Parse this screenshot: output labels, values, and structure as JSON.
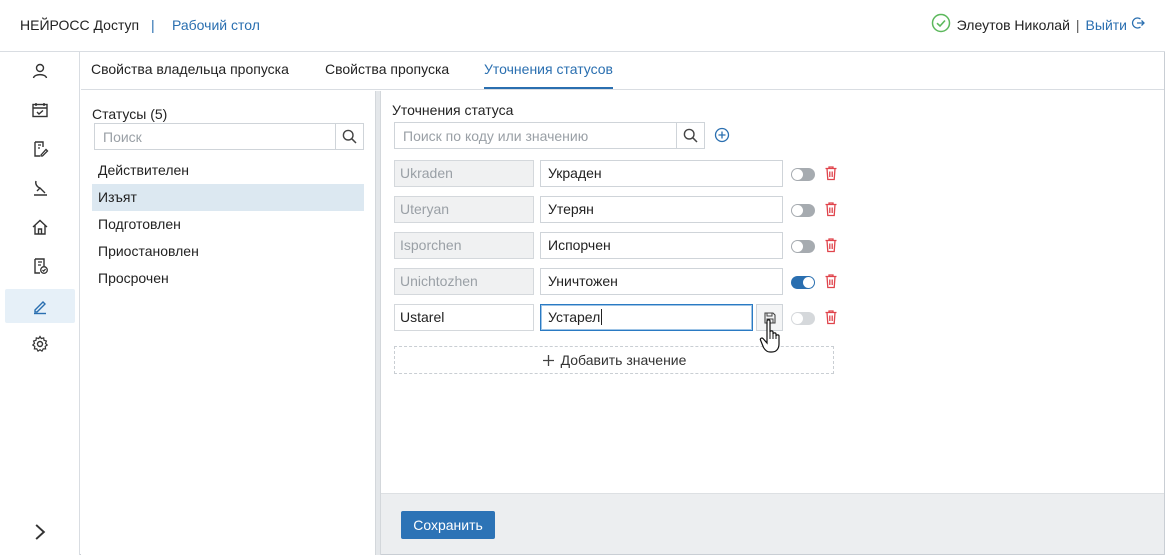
{
  "header": {
    "app_name": "НЕЙРОСС Доступ",
    "separator": "|",
    "desktop_link": "Рабочий стол",
    "user_name": "Элеутов Николай",
    "user_separator": "|",
    "logout_label": "Выйти"
  },
  "sidebar": {
    "items": [
      {
        "icon": "user-icon"
      },
      {
        "icon": "calendar-icon"
      },
      {
        "icon": "document-edit-icon"
      },
      {
        "icon": "turnstile-icon"
      },
      {
        "icon": "home-icon"
      },
      {
        "icon": "document-check-icon"
      },
      {
        "icon": "pencil-icon",
        "active": true
      },
      {
        "icon": "gear-icon"
      }
    ],
    "collapse_icon": "chevron-right-icon"
  },
  "tabs": [
    {
      "label": "Свойства владельца пропуска"
    },
    {
      "label": "Свойства пропуска"
    },
    {
      "label": "Уточнения статусов",
      "active": true
    }
  ],
  "statuses": {
    "title": "Статусы (5)",
    "search_placeholder": "Поиск",
    "items": [
      {
        "label": "Действителен"
      },
      {
        "label": "Изъят",
        "selected": true
      },
      {
        "label": "Подготовлен"
      },
      {
        "label": "Приостановлен"
      },
      {
        "label": "Просрочен"
      }
    ]
  },
  "refinements": {
    "title": "Уточнения статуса",
    "search_placeholder": "Поиск по коду или значению",
    "rows": [
      {
        "code": "Ukraden",
        "value": "Украден",
        "enabled": false
      },
      {
        "code": "Uteryan",
        "value": "Утерян",
        "enabled": false
      },
      {
        "code": "Isporchen",
        "value": "Испорчен",
        "enabled": false
      },
      {
        "code": "Unichtozhen",
        "value": "Уничтожен",
        "enabled": true
      },
      {
        "code": "Ustarel",
        "value": "Устарел",
        "enabled": false,
        "editing": true
      }
    ],
    "add_value_label": "Добавить значение"
  },
  "footer": {
    "save_label": "Сохранить"
  },
  "colors": {
    "accent": "#2a6fb0",
    "delete": "#e0434b",
    "ok": "#5cb85c"
  }
}
